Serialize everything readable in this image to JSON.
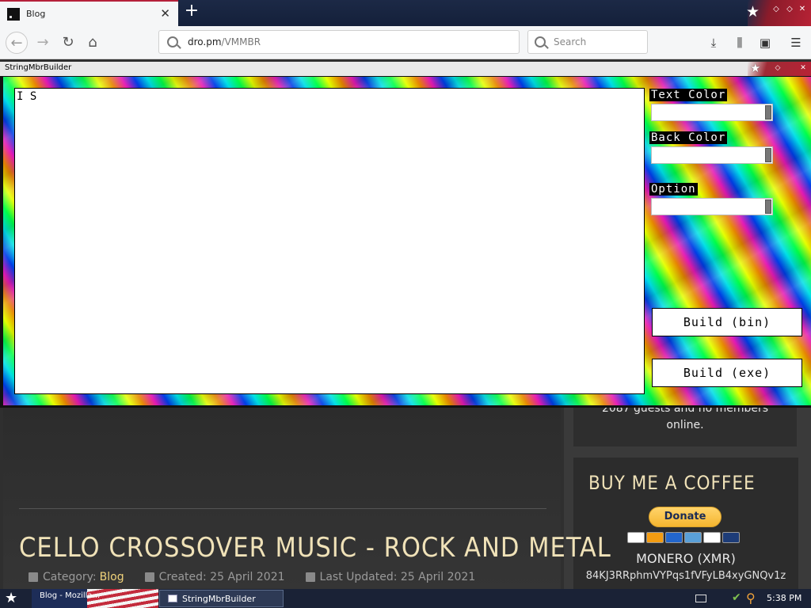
{
  "browser": {
    "tab_title": "Blog",
    "url_domain": "dro.pm",
    "url_path": "/VMMBR",
    "search_placeholder": "Search"
  },
  "page": {
    "online_line1": "2087 guests and no members",
    "online_line2": "online.",
    "coffee_title": "BUY ME A COFFEE",
    "donate_label": "Donate",
    "monero_label": "MONERO (XMR)",
    "monero_address": "84KJ3RRphmVYPqs1fVFyLB4xyGNQv1z",
    "article_title": "CELLO CROSSOVER MUSIC - ROCK AND METAL",
    "meta": {
      "category_prefix": "Category:",
      "category_value": "Blog",
      "created": "Created: 25 April 2021",
      "updated": "Last Updated: 25 April 2021"
    }
  },
  "app": {
    "title": "StringMbrBuilder",
    "editor_text": "I S",
    "text_color_label": "Text Color",
    "back_color_label": "Back Color",
    "option_label": "Option",
    "build_bin_label": "Build (bin)",
    "build_exe_label": "Build (exe)"
  },
  "taskbar": {
    "task1_label": "Blog - Mozilla...",
    "task2_label": "StringMbrBuilder",
    "clock": "5:38 PM"
  },
  "icons": [
    "new-tab-icon",
    "back-icon",
    "forward-icon",
    "reload-icon",
    "home-icon",
    "search-icon",
    "download-icon",
    "library-icon",
    "sidebar-icon",
    "menu-icon"
  ]
}
